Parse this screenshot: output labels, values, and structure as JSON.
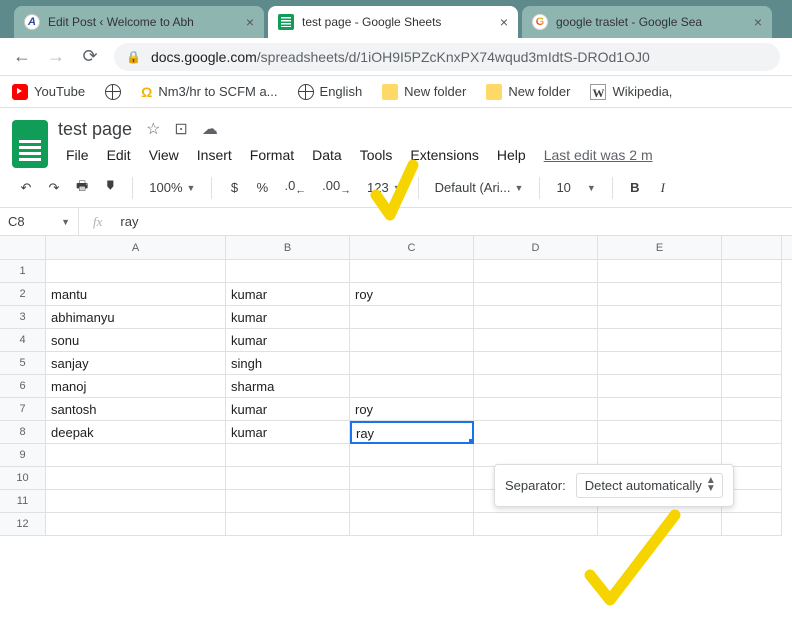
{
  "tabs": [
    {
      "title": "Edit Post ‹ Welcome to Abh"
    },
    {
      "title": "test page - Google Sheets"
    },
    {
      "title": "google traslet - Google Sea"
    }
  ],
  "url": {
    "domain": "docs.google.com",
    "path": "/spreadsheets/d/1iOH9I5PZcKnxPX74wqud3mIdtS-DROd1OJ0"
  },
  "bookmarks": {
    "yt": "YouTube",
    "nm3": "Nm3/hr to SCFM a...",
    "eng": "English",
    "nf1": "New folder",
    "nf2": "New folder",
    "wiki": "Wikipedia,"
  },
  "doc": {
    "title": "test page",
    "last_edit": "Last edit was 2 m"
  },
  "menu": {
    "file": "File",
    "edit": "Edit",
    "view": "View",
    "insert": "Insert",
    "format": "Format",
    "data": "Data",
    "tools": "Tools",
    "ext": "Extensions",
    "help": "Help"
  },
  "toolbar": {
    "zoom": "100%",
    "currency": "$",
    "pct": "%",
    "dec_less": ".0",
    "dec_more": ".00",
    "num": "123",
    "font": "Default (Ari...",
    "size": "10"
  },
  "namebox": "C8",
  "formula": "ray",
  "cols": [
    "A",
    "B",
    "C",
    "D",
    "E"
  ],
  "rows": [
    "1",
    "2",
    "3",
    "4",
    "5",
    "6",
    "7",
    "8",
    "9",
    "10",
    "11",
    "12"
  ],
  "cells": {
    "r2": {
      "a": "mantu",
      "b": "kumar",
      "c": "roy"
    },
    "r3": {
      "a": "abhimanyu",
      "b": "kumar"
    },
    "r4": {
      "a": "sonu",
      "b": "kumar"
    },
    "r5": {
      "a": "sanjay",
      "b": "singh"
    },
    "r6": {
      "a": "manoj",
      "b": "sharma"
    },
    "r7": {
      "a": "santosh",
      "b": "kumar",
      "c": "roy"
    },
    "r8": {
      "a": "deepak",
      "b": "kumar",
      "c": "ray"
    }
  },
  "popup": {
    "label": "Separator:",
    "value": "Detect automatically"
  }
}
